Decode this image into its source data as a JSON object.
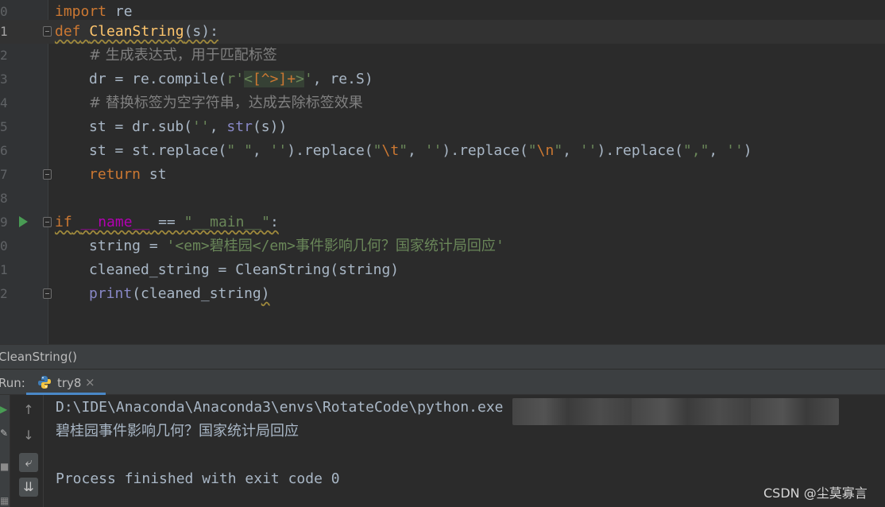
{
  "editor": {
    "lines": [
      {
        "num": "0"
      },
      {
        "num": "1"
      },
      {
        "num": "2"
      },
      {
        "num": "3"
      },
      {
        "num": "4"
      },
      {
        "num": "5"
      },
      {
        "num": "6"
      },
      {
        "num": "7"
      },
      {
        "num": "8"
      },
      {
        "num": "9"
      },
      {
        "num": "0"
      },
      {
        "num": "1"
      },
      {
        "num": "2"
      }
    ],
    "tokens": {
      "l0_import": "import",
      "l0_re": " re",
      "l1_def": "def",
      "l1_name": "CleanString",
      "l1_args": "(s):",
      "l2_comment": "# 生成表达式，用于匹配标签",
      "l3_a": "dr = re.compile(",
      "l3_r": "r'",
      "l3_lt": "<",
      "l3_class": "[^>]+",
      "l3_gt": ">",
      "l3_q": "'",
      "l3_b": ", re.S)",
      "l4_comment": "# 替换标签为空字符串，达成去除标签效果",
      "l5_a": "st = dr.sub(",
      "l5_str": "''",
      "l5_b": ", ",
      "l5_bi": "str",
      "l5_c": "(s))",
      "l6_a": "st = st.replace(",
      "l6_s1": "\" \"",
      "l6_b": ", ",
      "l6_s2": "''",
      "l6_c": ").replace(",
      "l6_s3a": "\"",
      "l6_e1": "\\t",
      "l6_s3b": "\"",
      "l6_d": ", ",
      "l6_s4": "''",
      "l6_e": ").replace(",
      "l6_s5a": "\"",
      "l6_e2": "\\n",
      "l6_s5b": "\"",
      "l6_f": ", ",
      "l6_s6": "''",
      "l6_g": ").replace(",
      "l6_s7": "\",\"",
      "l6_h": ", ",
      "l6_s8": "''",
      "l6_i": ")",
      "l7_return": "return",
      "l7_st": " st",
      "l9_if": "if",
      "l9_sp": " ",
      "l9_name": "__name__",
      "l9_eq": " == ",
      "l9_main": "\"__main__\"",
      "l9_colon": ":",
      "l10_a": "string = ",
      "l10_q1": "'",
      "l10_em1": "<em>",
      "l10_t1": "碧桂园",
      "l10_em2": "</em>",
      "l10_t2": "事件影响几何？国家统计局回应",
      "l10_q2": "'",
      "l11": "cleaned_string = CleanString(string)",
      "l12_print": "print",
      "l12_rest": "(cleaned_string",
      "l12_close": ")"
    }
  },
  "breadcrumb": "CleanString()",
  "run_panel": {
    "label": "Run:",
    "tab_label": "try8",
    "tab_close": "×",
    "tool_icons": [
      "arrow-up-icon",
      "arrow-down-icon",
      "soft-wrap-icon",
      "scroll-to-end-icon"
    ],
    "side_icons": [
      "rerun-icon",
      "settings-icon",
      "stop-icon",
      "layout-icon"
    ]
  },
  "console": {
    "command": "D:\\IDE\\Anaconda\\Anaconda3\\envs\\RotateCode\\python.exe",
    "output": "碧桂园事件影响几何？国家统计局回应",
    "exit": "Process finished with exit code 0"
  },
  "watermark": "CSDN @尘莫寡言",
  "colors": {
    "background": "#2b2b2b",
    "keyword": "#cc7832",
    "function": "#ffc66d",
    "string": "#6a8759",
    "comment": "#808080",
    "builtin": "#8888c6",
    "tab_accent": "#4a88c7",
    "run_green": "#499c54"
  }
}
